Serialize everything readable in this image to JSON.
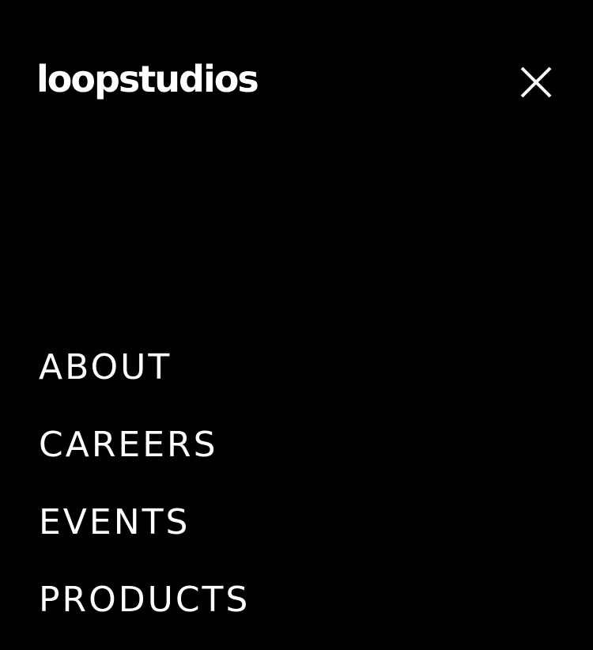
{
  "header": {
    "logo_text": "loopstudios",
    "close_icon": "close-icon"
  },
  "nav": {
    "items": [
      {
        "label": "ABOUT"
      },
      {
        "label": "CAREERS"
      },
      {
        "label": "EVENTS"
      },
      {
        "label": "PRODUCTS"
      }
    ]
  },
  "colors": {
    "background": "#000000",
    "text": "#ffffff"
  }
}
